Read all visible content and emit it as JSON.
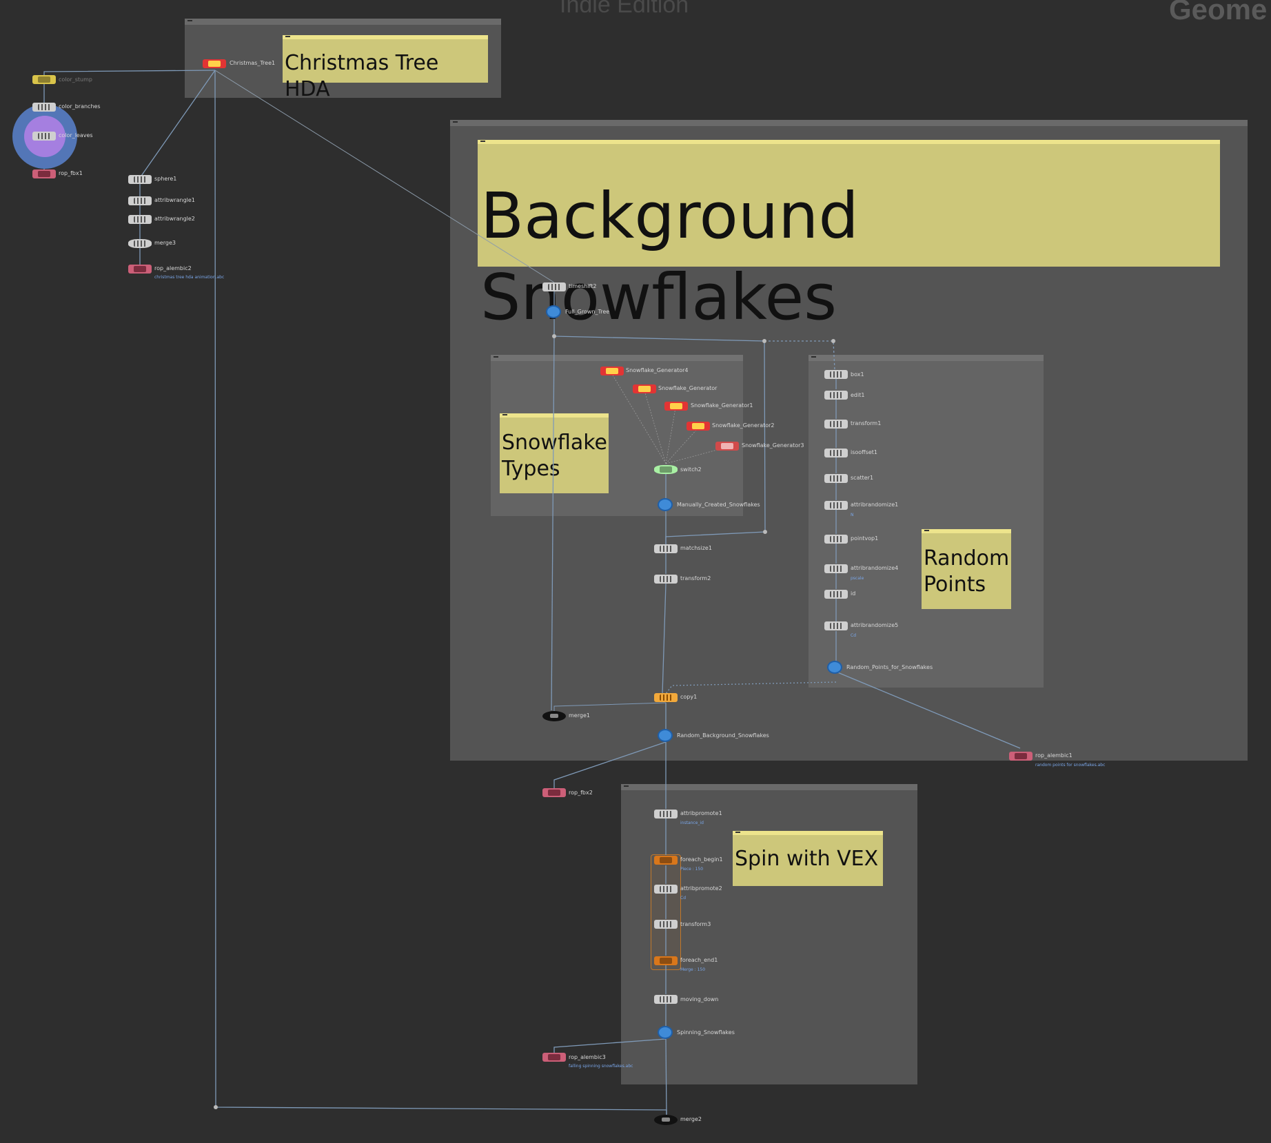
{
  "watermarks": {
    "edition": "Indie Edition",
    "context": "Geome"
  },
  "boxes": {
    "christmas_tree_hda": "Christmas Tree HDA",
    "background_snowflakes": "Background Snowflakes",
    "snowflake_types_line1": "Snowflake",
    "snowflake_types_line2": "Types",
    "random_points_line1": "Random",
    "random_points_line2": "Points",
    "spin_with_vex": "Spin with VEX"
  },
  "nodes": {
    "christmas_tree1": "Christmas_Tree1",
    "color_stump": "color_stump",
    "color_branches": "color_branches",
    "color_leaves": "color_leaves",
    "rop_fbx1": "rop_fbx1",
    "sphere1": "sphere1",
    "attribwrangle1": "attribwrangle1",
    "attribwrangle2": "attribwrangle2",
    "merge3": "merge3",
    "rop_alembic2": "rop_alembic2",
    "timeshift2": "timeshift2",
    "full_grown_tree": "Full_Grown_Tree",
    "sg4": "Snowflake_Generator4",
    "sg": "Snowflake_Generator",
    "sg1": "Snowflake_Generator1",
    "sg2": "Snowflake_Generator2",
    "sg3": "Snowflake_Generator3",
    "switch2": "switch2",
    "manual_snow": "Manually_Created_Snowflakes",
    "matchsize1": "matchsize1",
    "transform2": "transform2",
    "box1": "box1",
    "edit1": "edit1",
    "transform1": "transform1",
    "isooffset1": "isooffset1",
    "scatter1": "scatter1",
    "attribrandomize1": "attribrandomize1",
    "pointvop1": "pointvop1",
    "attribrandomize4": "attribrandomize4",
    "id": "id",
    "attribrandomize5": "attribrandomize5",
    "random_points": "Random_Points_for_Snowflakes",
    "copy1": "copy1",
    "merge1": "merge1",
    "random_bg": "Random_Background_Snowflakes",
    "rop_alembic1": "rop_alembic1",
    "rop_fbx2": "rop_fbx2",
    "attribpromote1": "attribpromote1",
    "foreach_begin1": "foreach_begin1",
    "attribpromote2": "attribpromote2",
    "transform3": "transform3",
    "foreach_end1": "foreach_end1",
    "moving_down": "moving_down",
    "spinning": "Spinning_Snowflakes",
    "rop_alembic3": "rop_alembic3",
    "merge2": "merge2"
  },
  "subs": {
    "rop_alembic2": "christmas tree hda animation.abc",
    "attribrandomize1": "N",
    "attribrandomize4": "pscale",
    "attribrandomize5": "Cd",
    "rop_alembic1": "random points for snowflakes.abc",
    "attribpromote1": "instance_id",
    "foreach_begin1": "Piece : 150",
    "attribpromote2": "Cd",
    "foreach_end1": "Merge : 150",
    "rop_alembic3": "falling spinning snowflakes.abc"
  },
  "colors": {
    "background": "#2e2e2e",
    "network_box": "#545454",
    "sticky_note": "#cdc77a",
    "wire": "#7f9ab8"
  }
}
